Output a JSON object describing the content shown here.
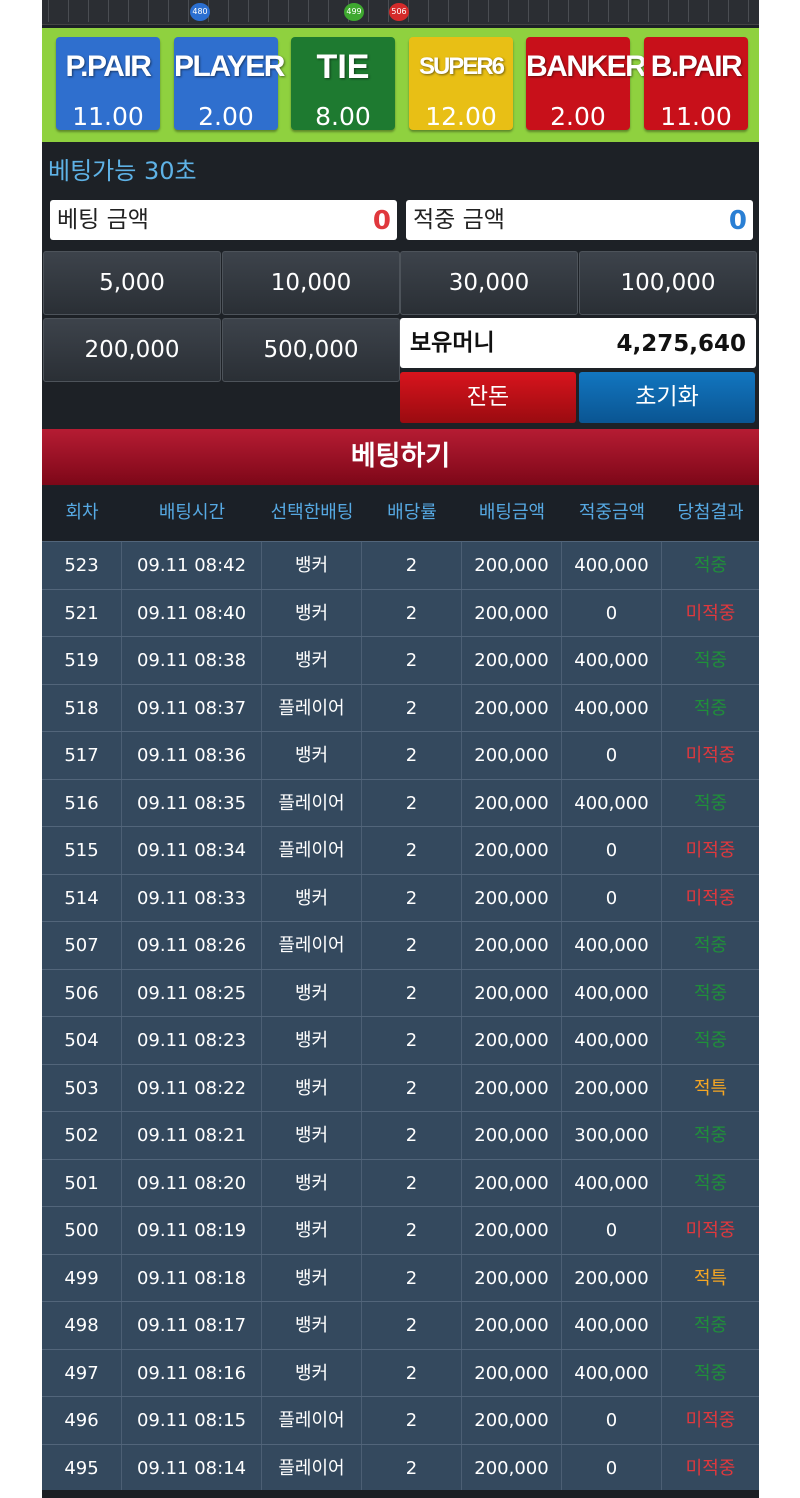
{
  "history_strip": {
    "markers": [
      {
        "label": "480",
        "color": "#2b6fd1"
      },
      {
        "label": "499",
        "color": "#3ea82f"
      },
      {
        "label": "506",
        "color": "#d42a2a"
      }
    ]
  },
  "bet_options": [
    {
      "name": "P.PAIR",
      "odds": "11.00",
      "color": "#2f6fce"
    },
    {
      "name": "PLAYER",
      "odds": "2.00",
      "color": "#2f6fce"
    },
    {
      "name": "TIE",
      "odds": "8.00",
      "color": "#1e7a30"
    },
    {
      "name": "SUPER6",
      "odds": "12.00",
      "color": "#e8bf15"
    },
    {
      "name": "BANKER",
      "odds": "2.00",
      "color": "#c8101a"
    },
    {
      "name": "B.PAIR",
      "odds": "11.00",
      "color": "#c8101a"
    }
  ],
  "status": {
    "text": "베팅가능 30초"
  },
  "bet_amount": {
    "label": "베팅 금액",
    "value": "0",
    "color": "#e0383d"
  },
  "win_amount": {
    "label": "적중 금액",
    "value": "0",
    "color": "#2a7fd4"
  },
  "chips": [
    "5,000",
    "10,000",
    "30,000",
    "100,000",
    "200,000",
    "500,000"
  ],
  "balance": {
    "label": "보유머니",
    "value": "4,275,640"
  },
  "actions": {
    "change_label": "잔돈",
    "reset_label": "초기화"
  },
  "submit_label": "베팅하기",
  "table": {
    "headers": [
      "회차",
      "배팅시간",
      "선택한배팅",
      "배당률",
      "배팅금액",
      "적중금액",
      "당첨결과"
    ],
    "rows": [
      [
        "523",
        "09.11 08:42",
        "뱅커",
        "2",
        "200,000",
        "400,000",
        "적중"
      ],
      [
        "521",
        "09.11 08:40",
        "뱅커",
        "2",
        "200,000",
        "0",
        "미적중"
      ],
      [
        "519",
        "09.11 08:38",
        "뱅커",
        "2",
        "200,000",
        "400,000",
        "적중"
      ],
      [
        "518",
        "09.11 08:37",
        "플레이어",
        "2",
        "200,000",
        "400,000",
        "적중"
      ],
      [
        "517",
        "09.11 08:36",
        "뱅커",
        "2",
        "200,000",
        "0",
        "미적중"
      ],
      [
        "516",
        "09.11 08:35",
        "플레이어",
        "2",
        "200,000",
        "400,000",
        "적중"
      ],
      [
        "515",
        "09.11 08:34",
        "플레이어",
        "2",
        "200,000",
        "0",
        "미적중"
      ],
      [
        "514",
        "09.11 08:33",
        "뱅커",
        "2",
        "200,000",
        "0",
        "미적중"
      ],
      [
        "507",
        "09.11 08:26",
        "플레이어",
        "2",
        "200,000",
        "400,000",
        "적중"
      ],
      [
        "506",
        "09.11 08:25",
        "뱅커",
        "2",
        "200,000",
        "400,000",
        "적중"
      ],
      [
        "504",
        "09.11 08:23",
        "뱅커",
        "2",
        "200,000",
        "400,000",
        "적중"
      ],
      [
        "503",
        "09.11 08:22",
        "뱅커",
        "2",
        "200,000",
        "200,000",
        "적특"
      ],
      [
        "502",
        "09.11 08:21",
        "뱅커",
        "2",
        "200,000",
        "300,000",
        "적중"
      ],
      [
        "501",
        "09.11 08:20",
        "뱅커",
        "2",
        "200,000",
        "400,000",
        "적중"
      ],
      [
        "500",
        "09.11 08:19",
        "뱅커",
        "2",
        "200,000",
        "0",
        "미적중"
      ],
      [
        "499",
        "09.11 08:18",
        "뱅커",
        "2",
        "200,000",
        "200,000",
        "적특"
      ],
      [
        "498",
        "09.11 08:17",
        "뱅커",
        "2",
        "200,000",
        "400,000",
        "적중"
      ],
      [
        "497",
        "09.11 08:16",
        "뱅커",
        "2",
        "200,000",
        "400,000",
        "적중"
      ],
      [
        "496",
        "09.11 08:15",
        "플레이어",
        "2",
        "200,000",
        "0",
        "미적중"
      ],
      [
        "495",
        "09.11 08:14",
        "플레이어",
        "2",
        "200,000",
        "0",
        "미적중"
      ]
    ]
  }
}
